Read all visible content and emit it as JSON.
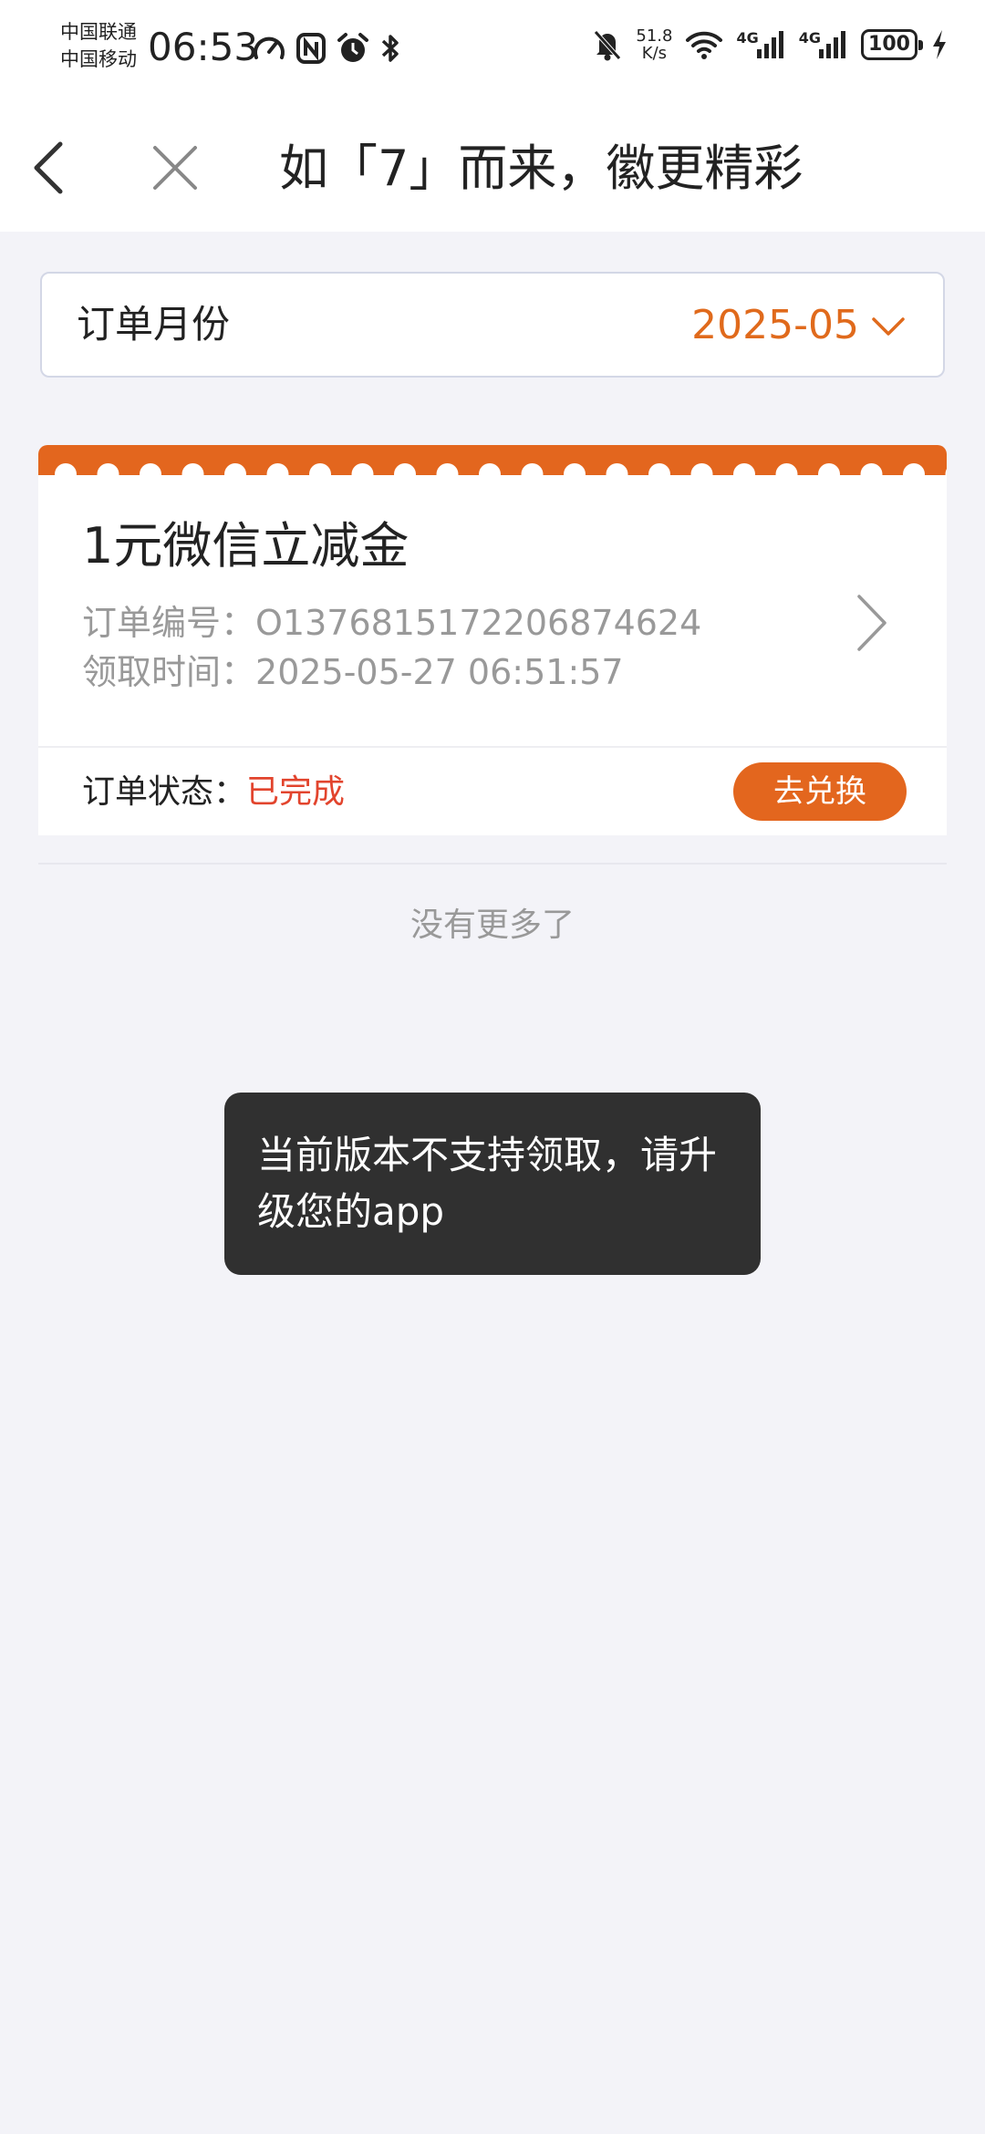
{
  "status_bar": {
    "carrier_1": "中国联通",
    "carrier_2": "中国移动",
    "time": "06:53",
    "net_speed_value": "51.8",
    "net_speed_unit": "K/s",
    "signal_1_label": "4G",
    "signal_2_label": "4G",
    "battery": "100",
    "icons_left": [
      "speedometer-icon",
      "nfc-icon",
      "alarm-icon",
      "bluetooth-icon"
    ],
    "icons_right": [
      "mute-bell-icon",
      "wifi-icon",
      "signal-icon",
      "signal-icon",
      "battery-icon",
      "charging-icon"
    ]
  },
  "header": {
    "title": "如「7」而来，徽更精彩",
    "back_icon": "chevron-left-icon",
    "close_icon": "close-icon"
  },
  "month_filter": {
    "label": "订单月份",
    "value": "2025-05",
    "icon": "chevron-down-icon"
  },
  "orders": [
    {
      "title": "1元微信立减金",
      "order_no_label": "订单编号：",
      "order_no": "O1376815172206874624",
      "claim_time_label": "领取时间：",
      "claim_time": "2025-05-27 06:51:57",
      "status_label": "订单状态：",
      "status": "已完成",
      "action_label": "去兑换"
    }
  ],
  "list_end_text": "没有更多了",
  "toast": {
    "line_1": "当前版本不支持领取，请升",
    "line_2": "级您的app"
  },
  "colors": {
    "accent": "#e3661e",
    "status_done": "#e2442d",
    "background": "#f3f3f8"
  }
}
